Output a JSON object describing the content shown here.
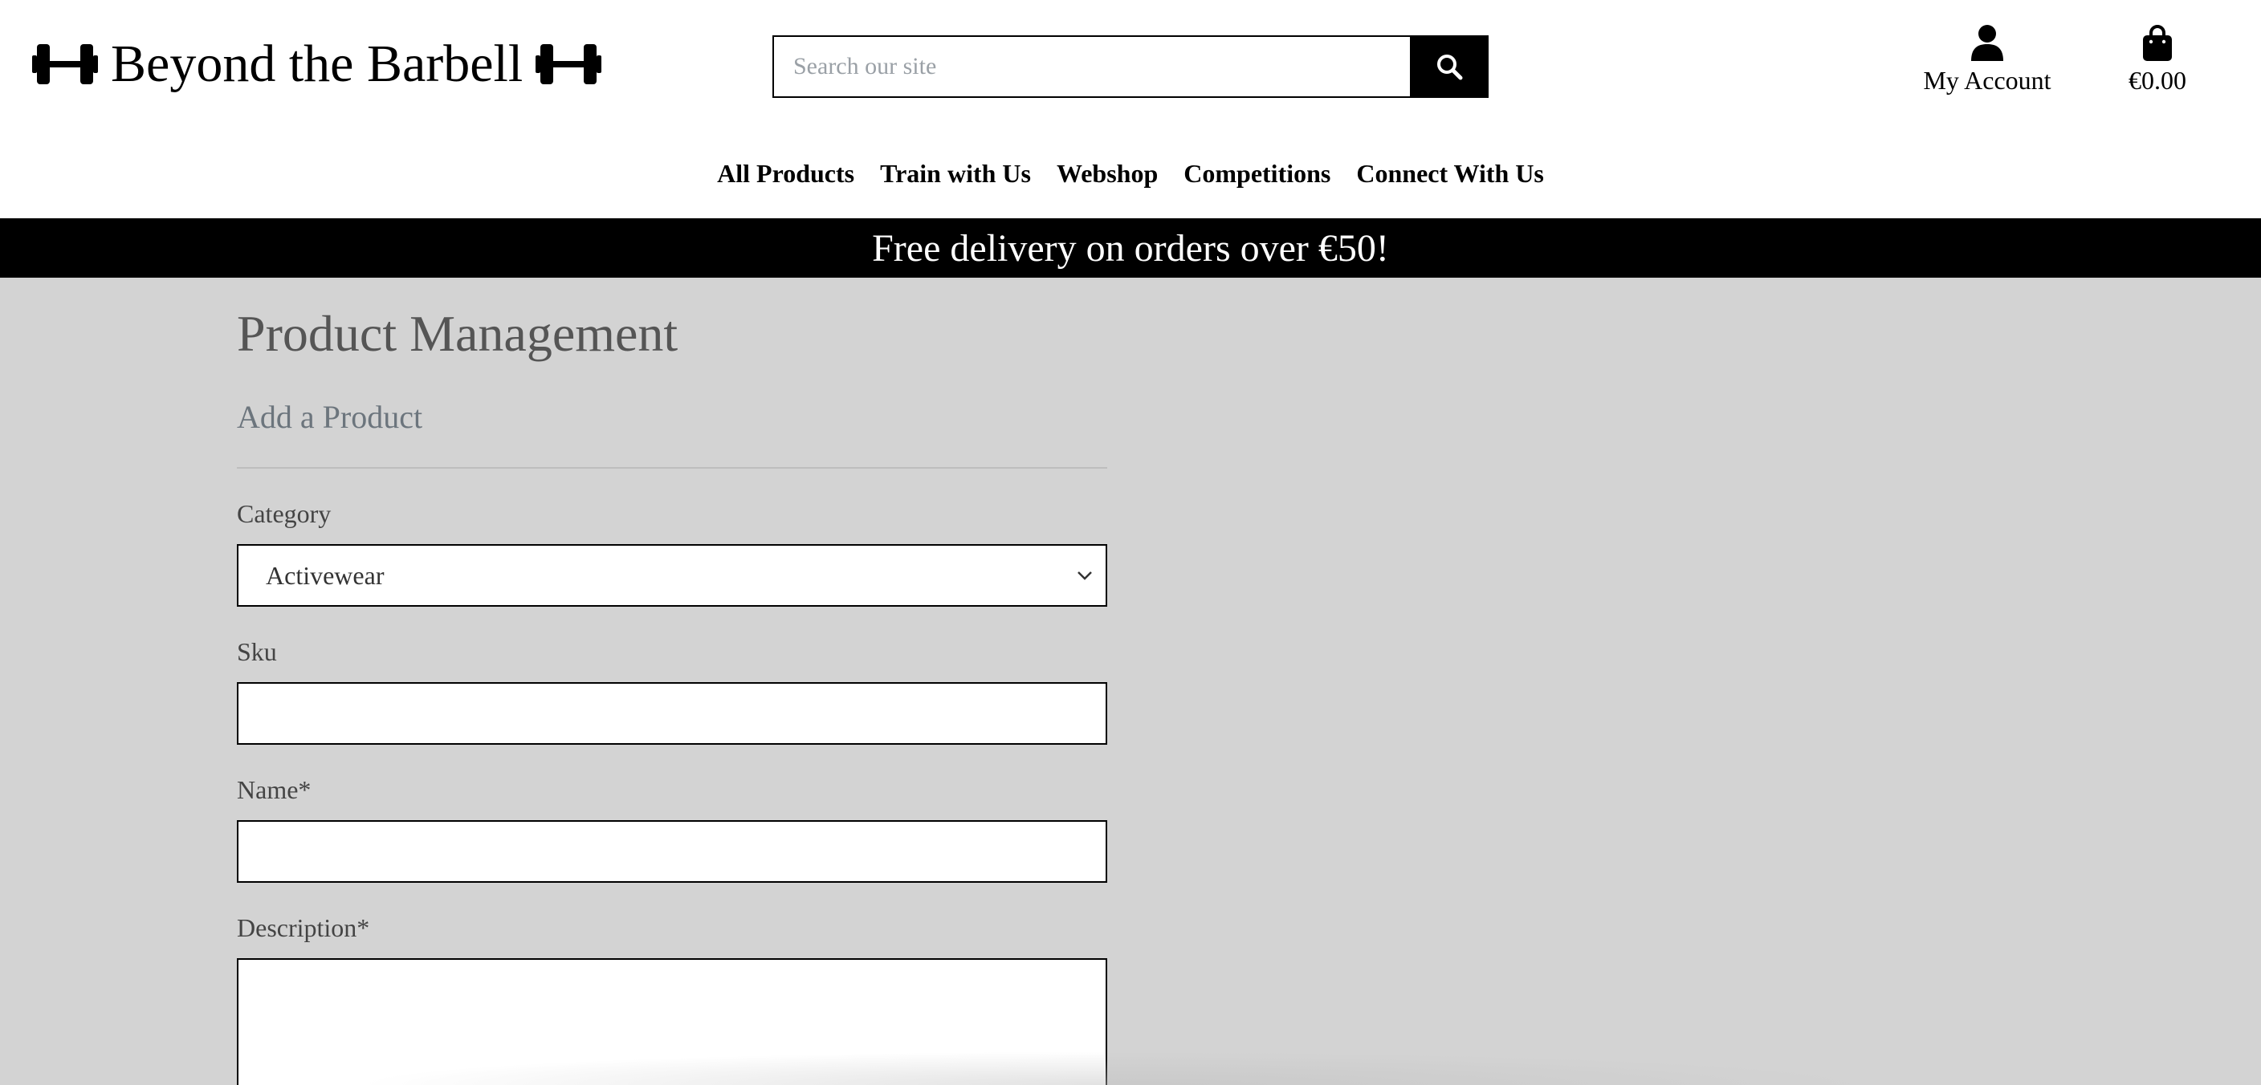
{
  "header": {
    "logo_text": "Beyond the Barbell",
    "search_placeholder": "Search our site",
    "account_label": "My Account",
    "bag_total": "€0.00"
  },
  "nav": {
    "items": [
      "All Products",
      "Train with Us",
      "Webshop",
      "Competitions",
      "Connect With Us"
    ]
  },
  "banner": {
    "text": "Free delivery on orders over €50!"
  },
  "main": {
    "page_title": "Product Management",
    "section_title": "Add a Product",
    "fields": {
      "category": {
        "label": "Category",
        "value": "Activewear"
      },
      "sku": {
        "label": "Sku",
        "value": ""
      },
      "name": {
        "label": "Name*",
        "value": ""
      },
      "description": {
        "label": "Description*",
        "value": ""
      }
    }
  },
  "icons": {
    "logo_left": "dumbbell-icon",
    "logo_right": "dumbbell-icon",
    "search": "search-icon",
    "account": "user-icon",
    "bag": "shopping-bag-icon",
    "select": "chevron-down-icon"
  },
  "colors": {
    "header_bg": "#ffffff",
    "banner_bg": "#000000",
    "page_bg": "#d3d3d3"
  }
}
